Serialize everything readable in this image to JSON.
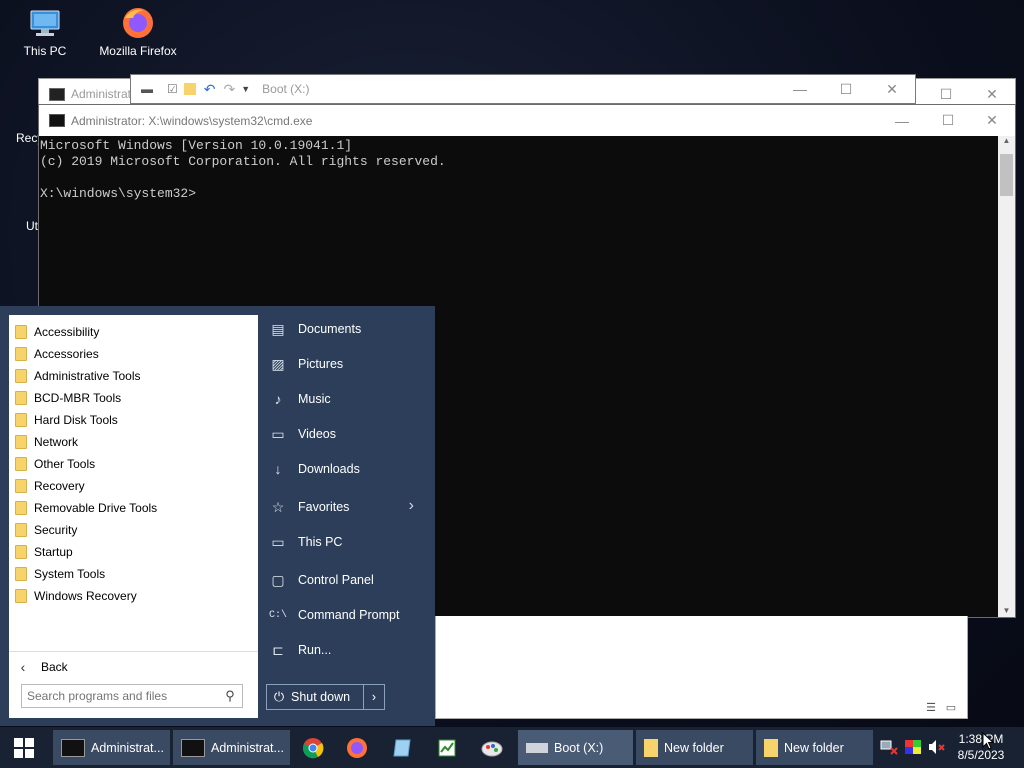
{
  "desktop": {
    "icons": [
      {
        "label": "This PC",
        "icon": "computer-icon"
      },
      {
        "label": "Mozilla Firefox",
        "icon": "firefox-icon"
      }
    ],
    "fragments": [
      "Recy",
      "Ut"
    ]
  },
  "windows": {
    "back_window_title": "Administrat",
    "explorer_title": "Boot (X:)"
  },
  "cmd": {
    "title": "Administrator: X:\\windows\\system32\\cmd.exe",
    "lines": [
      "Microsoft Windows [Version 10.0.19041.1]",
      "(c) 2019 Microsoft Corporation. All rights reserved.",
      "",
      "X:\\windows\\system32>"
    ]
  },
  "start_menu": {
    "programs": [
      "Accessibility",
      "Accessories",
      "Administrative Tools",
      "BCD-MBR Tools",
      "Hard Disk Tools",
      "Network",
      "Other Tools",
      "Recovery",
      "Removable Drive Tools",
      "Security",
      "Startup",
      "System Tools",
      "Windows Recovery"
    ],
    "back_label": "Back",
    "search_placeholder": "Search programs and files",
    "right_items": [
      {
        "label": "Documents",
        "icon": "document-icon"
      },
      {
        "label": "Pictures",
        "icon": "picture-icon"
      },
      {
        "label": "Music",
        "icon": "music-icon"
      },
      {
        "label": "Videos",
        "icon": "video-icon"
      },
      {
        "label": "Downloads",
        "icon": "download-icon"
      },
      {
        "label": "Favorites",
        "icon": "star-icon"
      },
      {
        "label": "This PC",
        "icon": "computer-icon"
      },
      {
        "label": "Control Panel",
        "icon": "control-panel-icon"
      },
      {
        "label": "Command Prompt",
        "icon": "command-prompt-icon"
      },
      {
        "label": "Run...",
        "icon": "run-icon"
      }
    ],
    "shutdown_label": "Shut down"
  },
  "taskbar": {
    "tasks": [
      {
        "label": "Administrat...",
        "icon": "cmd-icon"
      },
      {
        "label": "Administrat...",
        "icon": "cmd-icon"
      },
      {
        "label": "Boot (X:)",
        "icon": "drive-icon"
      },
      {
        "label": "New folder",
        "icon": "folder-icon"
      },
      {
        "label": "New folder",
        "icon": "folder-icon"
      }
    ],
    "pinned": [
      "chrome-icon",
      "firefox-icon",
      "notepad-icon",
      "spreadsheet-icon",
      "paint-icon"
    ],
    "clock": {
      "time": "1:38 PM",
      "date": "8/5/2023"
    }
  },
  "colors": {
    "start_menu_bg": "#2c3e5a",
    "taskbar_bg": "#192232",
    "task_button_bg": "#3a4a63",
    "console_bg": "#0c0c0c",
    "console_text": "#cccccc"
  }
}
